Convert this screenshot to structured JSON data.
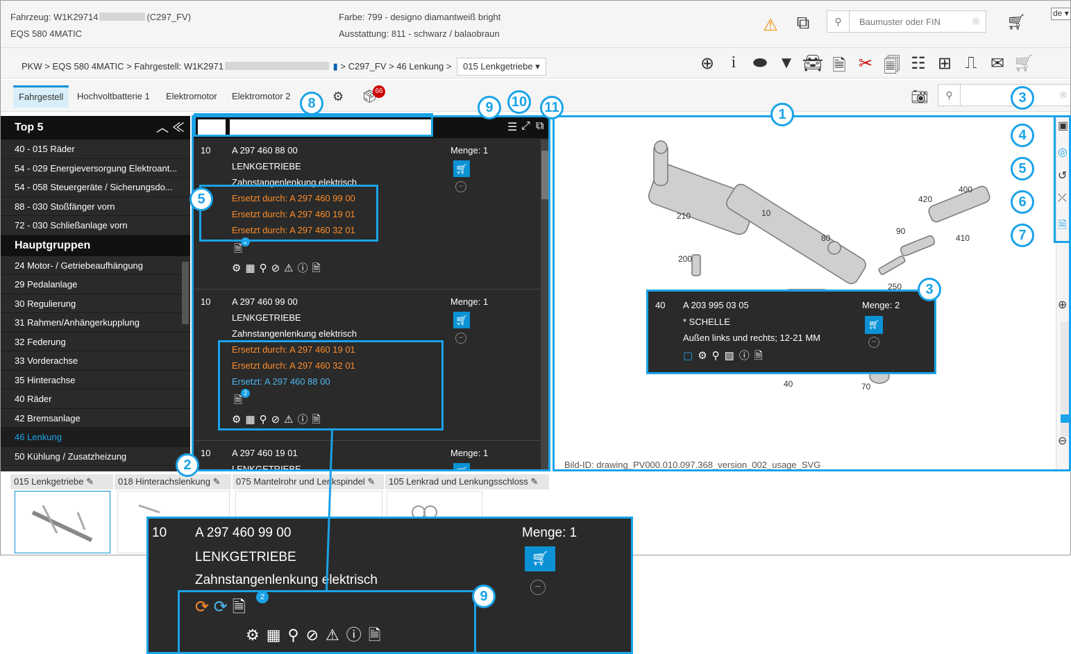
{
  "header": {
    "vehicle_prefix": "Fahrzeug: W1K29714",
    "vehicle_suffix": "(C297_FV)",
    "model": "EQS 580 4MATIC",
    "color": "Farbe: 799 - designo diamantweiß bright",
    "equipment": "Ausstattung: 811 - schwarz / balaobraun",
    "search_placeholder": "Baumuster oder FIN",
    "lang": "de"
  },
  "breadcrumb": {
    "pkw": "PKW",
    "model": "EQS 580 4MATIC",
    "chassis": "Fahrgestell: W1K2971",
    "c297": "C297_FV",
    "group": "46 Lenkung",
    "sub": "015 Lenkgetriebe ▾"
  },
  "tabs": [
    "Fahrgestell",
    "Hochvoltbatterie 1",
    "Elektromotor",
    "Elektromotor 2"
  ],
  "tab_badge": "66",
  "sidebar": {
    "top5_title": "Top 5",
    "top5": [
      "40 - 015 Räder",
      "54 - 029 Energieversorgung Elektroant...",
      "54 - 058 Steuergeräte / Sicherungsdo...",
      "88 - 030 Stoßfänger vorn",
      "72 - 030 Schließanlage vorn"
    ],
    "groups_title": "Hauptgruppen",
    "groups": [
      "24 Motor- / Getriebeaufhängung",
      "29 Pedalanlage",
      "30 Regulierung",
      "31 Rahmen/Anhängerkupplung",
      "32 Federung",
      "33 Vorderachse",
      "35 Hinterachse",
      "40 Räder",
      "42 Bremsanlage",
      "46 Lenkung",
      "50 Kühlung / Zusatzheizung"
    ]
  },
  "parts": [
    {
      "pos": "10",
      "nr": "A 297 460 88 00",
      "name": "LENKGETRIEBE",
      "desc": "Zahnstangenlenkung elektrisch",
      "qty": "Menge: 1",
      "r1": "Ersetzt durch: A 297 460 99 00",
      "r2": "Ersetzt durch: A 297 460 19 01",
      "r3": "Ersetzt durch: A 297 460 32 01",
      "badge": "2"
    },
    {
      "pos": "10",
      "nr": "A 297 460 99 00",
      "name": "LENKGETRIEBE",
      "desc": "Zahnstangenlenkung elektrisch",
      "qty": "Menge: 1",
      "r1": "Ersetzt durch: A 297 460 19 01",
      "r2": "Ersetzt durch: A 297 460 32 01",
      "r3": "Ersetzt: A 297 460 88 00",
      "badge": "2"
    },
    {
      "pos": "10",
      "nr": "A 297 460 19 01",
      "name": "LENKGETRIEBE",
      "qty": "Menge: 1"
    }
  ],
  "callout": {
    "pos": "40",
    "nr": "A 203 995 03 05",
    "name": "* SCHELLE",
    "desc": "Außen links und rechts; 12-21 MM",
    "qty": "Menge: 2"
  },
  "drawing": {
    "bild_id": "Bild-ID: drawing_PV000.010.097.368_version_002_usage_SVG",
    "labels": [
      "210",
      "10",
      "80",
      "420",
      "400",
      "90",
      "410",
      "200",
      "250",
      "40",
      "70"
    ]
  },
  "thumbs": [
    "015 Lenkgetriebe",
    "018 Hinterachslenkung",
    "075 Mantelrohr und Lenkspindel",
    "105 Lenkrad und Lenkungsschloss"
  ],
  "zoom": {
    "pos": "10",
    "nr": "A 297 460 99 00",
    "name": "LENKGETRIEBE",
    "desc": "Zahnstangenlenkung elektrisch",
    "qty": "Menge: 1",
    "badge": "2"
  },
  "markers": [
    "1",
    "2",
    "3",
    "4",
    "5",
    "6",
    "7",
    "8",
    "9",
    "10",
    "11",
    "3",
    "5",
    "9"
  ],
  "colors": {
    "accent": "#1aa3e8",
    "orange": "#ff8c2a",
    "dark": "#2a2a2a"
  }
}
